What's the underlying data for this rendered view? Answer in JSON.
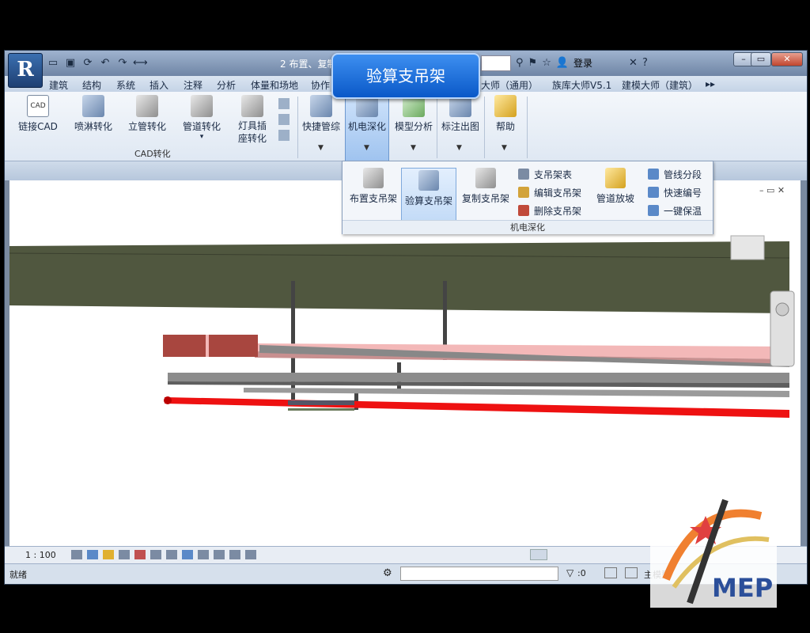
{
  "app": {
    "logo_letter": "R",
    "doc_title": "2 布置、复制",
    "login_label": "登录",
    "qat_icons": [
      "open-icon",
      "save-icon",
      "sync-icon",
      "undo-icon",
      "redo-icon",
      "measure-icon"
    ],
    "win_controls": [
      "minimize-icon",
      "restore-icon",
      "close-icon"
    ]
  },
  "menu": {
    "items": [
      "建筑",
      "结构",
      "系统",
      "插入",
      "注释",
      "分析",
      "体量和场地",
      "协作",
      "大师（通用）",
      "族库大师V5.1",
      "建模大师（建筑）"
    ]
  },
  "ribbon": {
    "cad_tools": [
      "链接CAD",
      "喷淋转化",
      "立管转化",
      "管道转化",
      "灯具插座转化"
    ],
    "cad_group": "CAD转化",
    "tools": [
      "快捷管综",
      "机电深化",
      "模型分析",
      "标注出图",
      "帮助"
    ]
  },
  "popup": {
    "large": [
      "布置支吊架",
      "验算支吊架",
      "复制支吊架"
    ],
    "small_col1": [
      "支吊架表",
      "编辑支吊架",
      "删除支吊架"
    ],
    "slope": "管道放坡",
    "small_col2": [
      "管线分段",
      "快速编号",
      "一键保温"
    ],
    "group_label": "机电深化"
  },
  "tooltip": "验算支吊架",
  "status": {
    "scale": "1 : 100",
    "ready": "就绪",
    "count": ":0",
    "view": "主模型"
  },
  "logo_text": "MEP",
  "colors": {
    "accent_blue": "#0a58c8",
    "pipe_red": "#ee1111",
    "duct_brown": "#a8463f",
    "slab": "#50573f"
  }
}
